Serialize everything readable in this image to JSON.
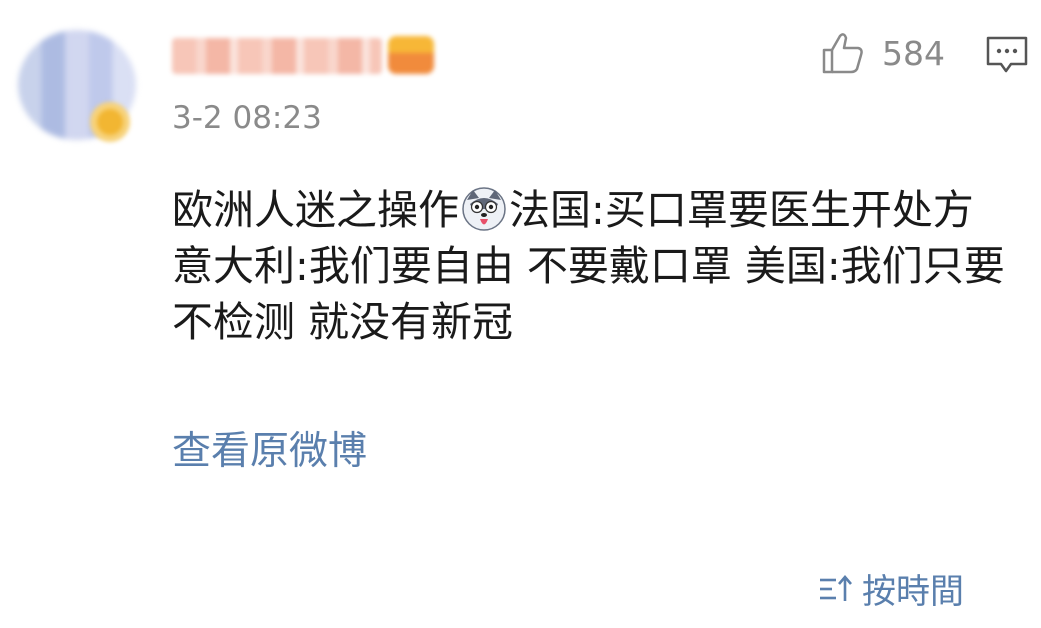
{
  "comment": {
    "timestamp": "3-2 08:23",
    "like_count": "584",
    "text_before_emoji": "欧洲人迷之操作",
    "text_after_emoji": "法国:买口罩要医生开处方 意大利:我们要自由 不要戴口罩 美国:我们只要不检测 就没有新冠",
    "emoji": "husky-emoji"
  },
  "actions": {
    "view_original": "查看原微博",
    "sort_label": "按時間"
  },
  "colors": {
    "link": "#5a7fad",
    "meta": "#8a8a8a",
    "text": "#1a1a1a"
  }
}
